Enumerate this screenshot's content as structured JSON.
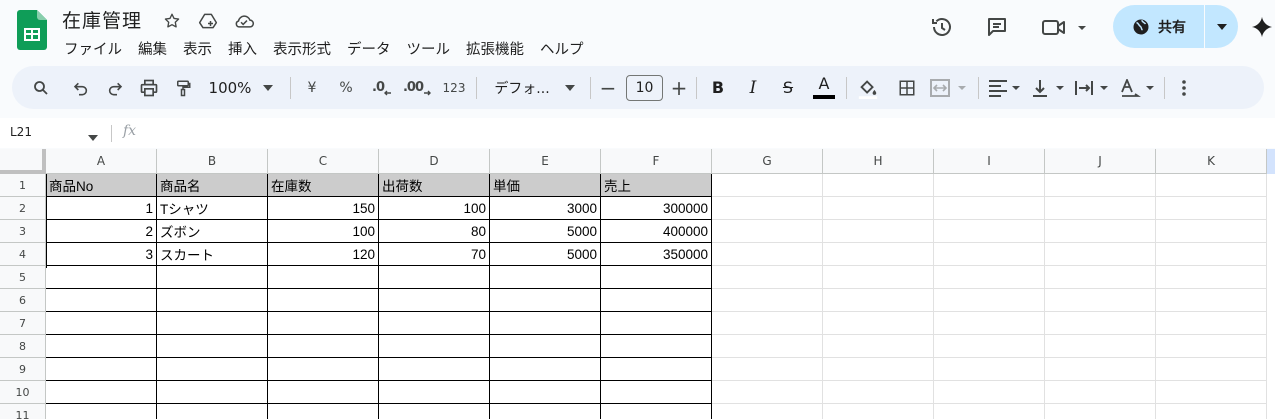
{
  "doc": {
    "title": "在庫管理",
    "icons": [
      "star-icon",
      "move-to-drive-icon",
      "cloud-saved-icon"
    ]
  },
  "menu": [
    "ファイル",
    "編集",
    "表示",
    "挿入",
    "表示形式",
    "データ",
    "ツール",
    "拡張機能",
    "ヘルプ"
  ],
  "header_right": {
    "share_label": "共有",
    "icons": [
      "history-icon",
      "comment-icon",
      "meet-icon",
      "gemini-icon"
    ]
  },
  "toolbar": {
    "zoom": "100%",
    "currency": "¥",
    "percent": "%",
    "dec_less": ".0",
    "dec_more": ".00",
    "number_format": "123",
    "font": "デフォ...",
    "font_size": "10",
    "minus": "−",
    "plus": "+",
    "bold": "B",
    "italic": "I",
    "strike": "S",
    "text_color_letter": "A",
    "text_color": "#000000"
  },
  "formula_bar": {
    "name_box": "L21",
    "fx_label": "fx"
  },
  "columns": [
    "A",
    "B",
    "C",
    "D",
    "E",
    "F",
    "G",
    "H",
    "I",
    "J",
    "K"
  ],
  "row_numbers": [
    "1",
    "2",
    "3",
    "4",
    "5",
    "6",
    "7",
    "8",
    "9",
    "10",
    "11"
  ],
  "table": {
    "header_fill": "#cccccc",
    "headers": [
      "商品No",
      "商品名",
      "在庫数",
      "出荷数",
      "単価",
      "売上"
    ],
    "rows": [
      [
        "1",
        "Tシャツ",
        "150",
        "100",
        "3000",
        "300000"
      ],
      [
        "2",
        "ズボン",
        "100",
        "80",
        "5000",
        "400000"
      ],
      [
        "3",
        "スカート",
        "120",
        "70",
        "5000",
        "350000"
      ]
    ]
  },
  "colors": {
    "accent_share": "#c2e7ff",
    "logo_green": "#0f9d58",
    "toolbar_bg": "#edf2fa"
  }
}
